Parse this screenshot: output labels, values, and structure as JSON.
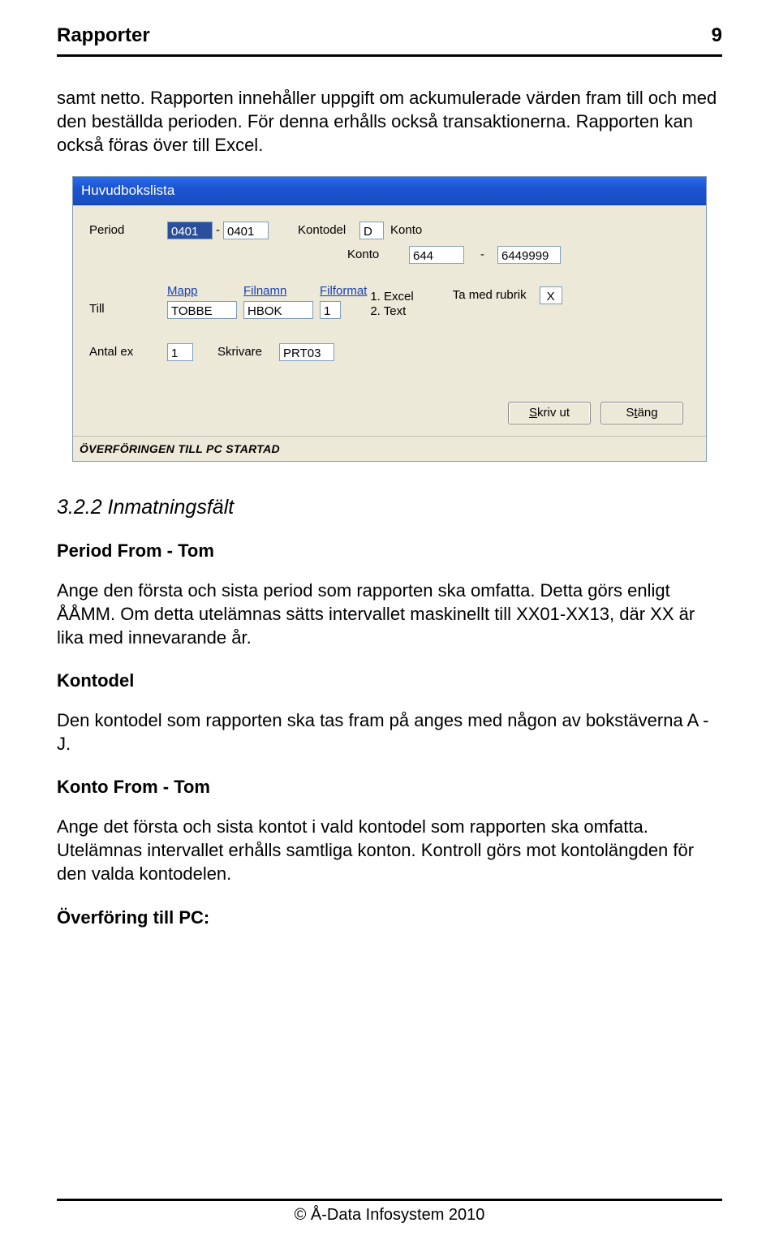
{
  "header": {
    "left": "Rapporter",
    "right": "9"
  },
  "intro": "samt netto. Rapporten innehåller uppgift om ackumulerade värden fram till och med den beställda perioden. För denna erhålls också transaktionerna. Rapporten kan också föras över till Excel.",
  "dialog": {
    "title": "Huvudbokslista",
    "labels": {
      "period": "Period",
      "kontodel": "Kontodel",
      "konto_short": "Konto",
      "konto": "Konto",
      "mapp": "Mapp",
      "filnamn": "Filnamn",
      "filformat": "Filformat",
      "till": "Till",
      "tamed": "Ta med rubrik",
      "antalex": "Antal ex",
      "skrivare": "Skrivare"
    },
    "values": {
      "period_from": "0401",
      "period_to": "0401",
      "kontodel": "D",
      "konto_from": "644",
      "konto_to": "6449999",
      "mapp": "TOBBE",
      "filnamn": "HBOK",
      "filformat_idx": "1",
      "filformat_options": {
        "opt1": "1. Excel",
        "opt2": "2. Text"
      },
      "rubrik": "X",
      "antalex": "1",
      "skrivare": "PRT03"
    },
    "buttons": {
      "skrivut": "Skriv ut",
      "stang": "Stäng"
    },
    "status": "ÖVERFÖRINGEN TILL PC STARTAD"
  },
  "sections": {
    "num": "3.2.2 Inmatningsfält",
    "period_title": "Period From - Tom",
    "period_text": "Ange den första och sista period som rapporten ska omfatta. Detta görs enligt ÅÅMM. Om detta utelämnas sätts intervallet maskinellt till XX01-XX13, där XX är lika med innevarande år.",
    "kontodel_title": "Kontodel",
    "kontodel_text": "Den kontodel som rapporten ska tas fram på anges med någon av bokstäverna A - J.",
    "konto_title": "Konto From - Tom",
    "konto_text": "Ange det första och sista kontot i vald kontodel som rapporten ska omfatta. Utelämnas intervallet erhålls samtliga konton. Kontroll görs mot kontolängden för den valda kontodelen.",
    "pc_title": "Överföring till PC:"
  },
  "footer": "© Å-Data Infosystem 2010"
}
